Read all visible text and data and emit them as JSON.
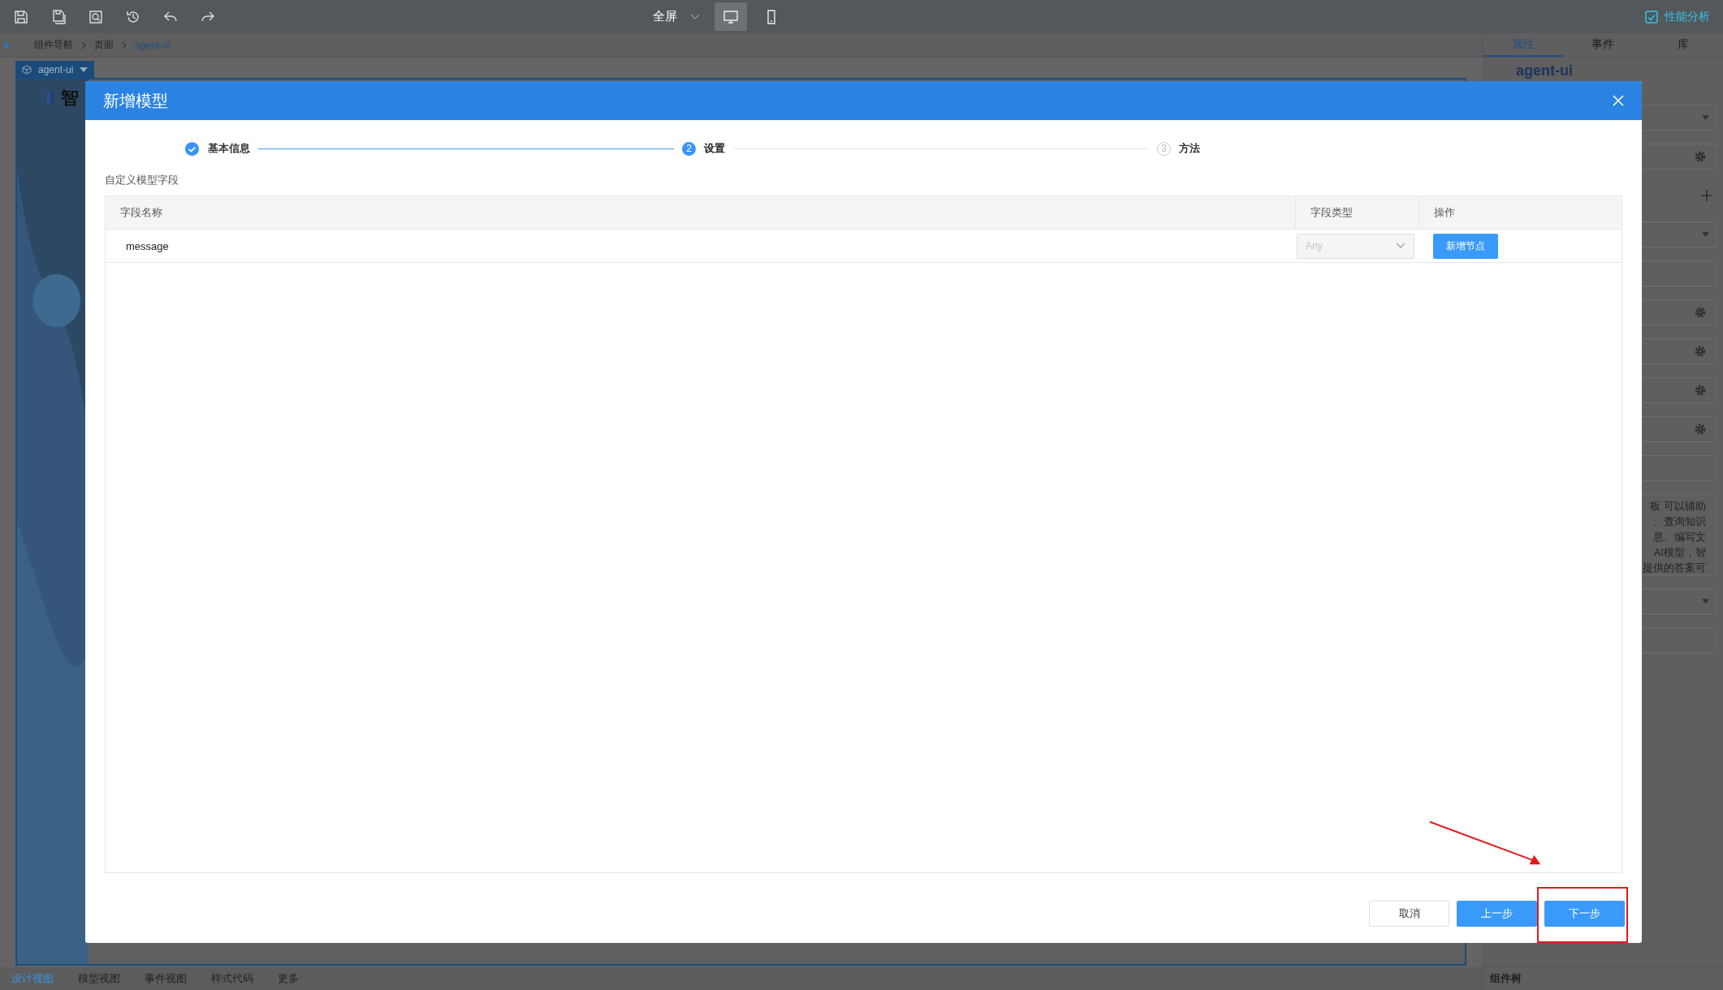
{
  "toolbar": {
    "view_mode": "全屏",
    "devices": [
      {
        "kind": "desktop",
        "selected": true
      },
      {
        "kind": "mobile",
        "selected": false
      }
    ],
    "performance": {
      "label": "性能分析",
      "checked": true
    }
  },
  "breadcrumb": [
    "组件导航",
    "页面",
    "agent-ui"
  ],
  "canvas": {
    "tag": "agent-ui",
    "heading": "智"
  },
  "right_tabs": [
    {
      "label": "属性",
      "selected": true
    },
    {
      "label": "事件",
      "selected": false
    },
    {
      "label": "库",
      "selected": false
    }
  ],
  "properties": {
    "title": "agent-ui",
    "description_lines": [
      "板 可以辅助",
      "、查询知识",
      "息、编写文",
      "AI模型，智",
      "提供的答案可"
    ]
  },
  "bottom_tabs": [
    {
      "label": "设计视图",
      "selected": true
    },
    {
      "label": "模型视图",
      "selected": false
    },
    {
      "label": "事件视图",
      "selected": false
    },
    {
      "label": "样式代码",
      "selected": false
    },
    {
      "label": "更多",
      "selected": false
    }
  ],
  "component_tree": "组件树",
  "dialog": {
    "title": "新增模型",
    "steps": [
      {
        "label": "基本信息",
        "done": true,
        "selected": false
      },
      {
        "number": "2",
        "label": "设置",
        "done": false,
        "selected": true
      },
      {
        "number": "3",
        "label": "方法",
        "done": false,
        "selected": false
      }
    ],
    "section_label": "自定义模型字段",
    "columns": [
      "字段名称",
      "字段类型",
      "操作"
    ],
    "rows": [
      {
        "name": "message",
        "type": {
          "value": "Any",
          "disabled": true
        },
        "action": "新增节点"
      }
    ],
    "buttons": [
      {
        "label": "取消",
        "kind": "default"
      },
      {
        "label": "上一步",
        "kind": "primary"
      },
      {
        "label": "下一步",
        "kind": "primary"
      }
    ]
  }
}
